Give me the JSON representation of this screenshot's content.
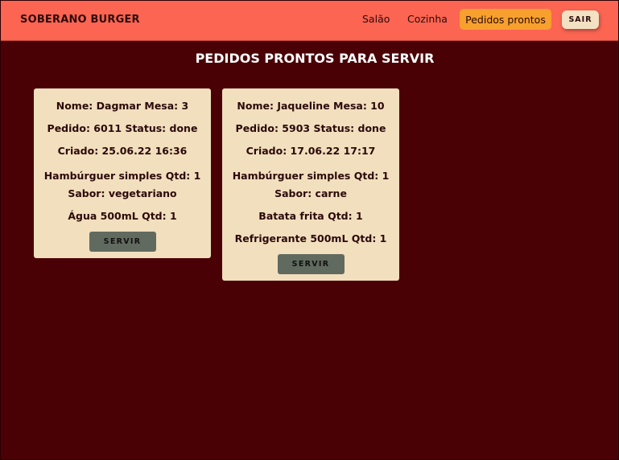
{
  "header": {
    "brand": "SOBERANO BURGER",
    "nav": {
      "salao": "Salão",
      "cozinha": "Cozinha",
      "pedidos_prontos": "Pedidos prontos"
    },
    "logout_label": "SAIR"
  },
  "main": {
    "title": "PEDIDOS PRONTOS PARA SERVIR",
    "orders": [
      {
        "name_line": "Nome: Dagmar Mesa: 3",
        "order_line": "Pedido: 6011 Status: done",
        "created_line": "Criado: 25.06.22 16:36",
        "items": [
          {
            "line1": "Hambúrguer simples Qtd: 1",
            "line2": "Sabor: vegetariano"
          },
          {
            "line1": "Água 500mL Qtd: 1"
          }
        ],
        "serve_label": "SERVIR"
      },
      {
        "name_line": "Nome: Jaqueline Mesa: 10",
        "order_line": "Pedido: 5903 Status: done",
        "created_line": "Criado: 17.06.22 17:17",
        "items": [
          {
            "line1": "Hambúrguer simples Qtd: 1",
            "line2": "Sabor: carne"
          },
          {
            "line1": "Batata frita Qtd: 1"
          },
          {
            "line1": "Refrigerante 500mL Qtd: 1"
          }
        ],
        "serve_label": "SERVIR"
      }
    ]
  },
  "colors": {
    "navbar": "#fb6552",
    "background": "#4a0106",
    "card": "#f2dfbe",
    "active_nav": "#f7a02d",
    "serve_button": "#616a5f"
  }
}
